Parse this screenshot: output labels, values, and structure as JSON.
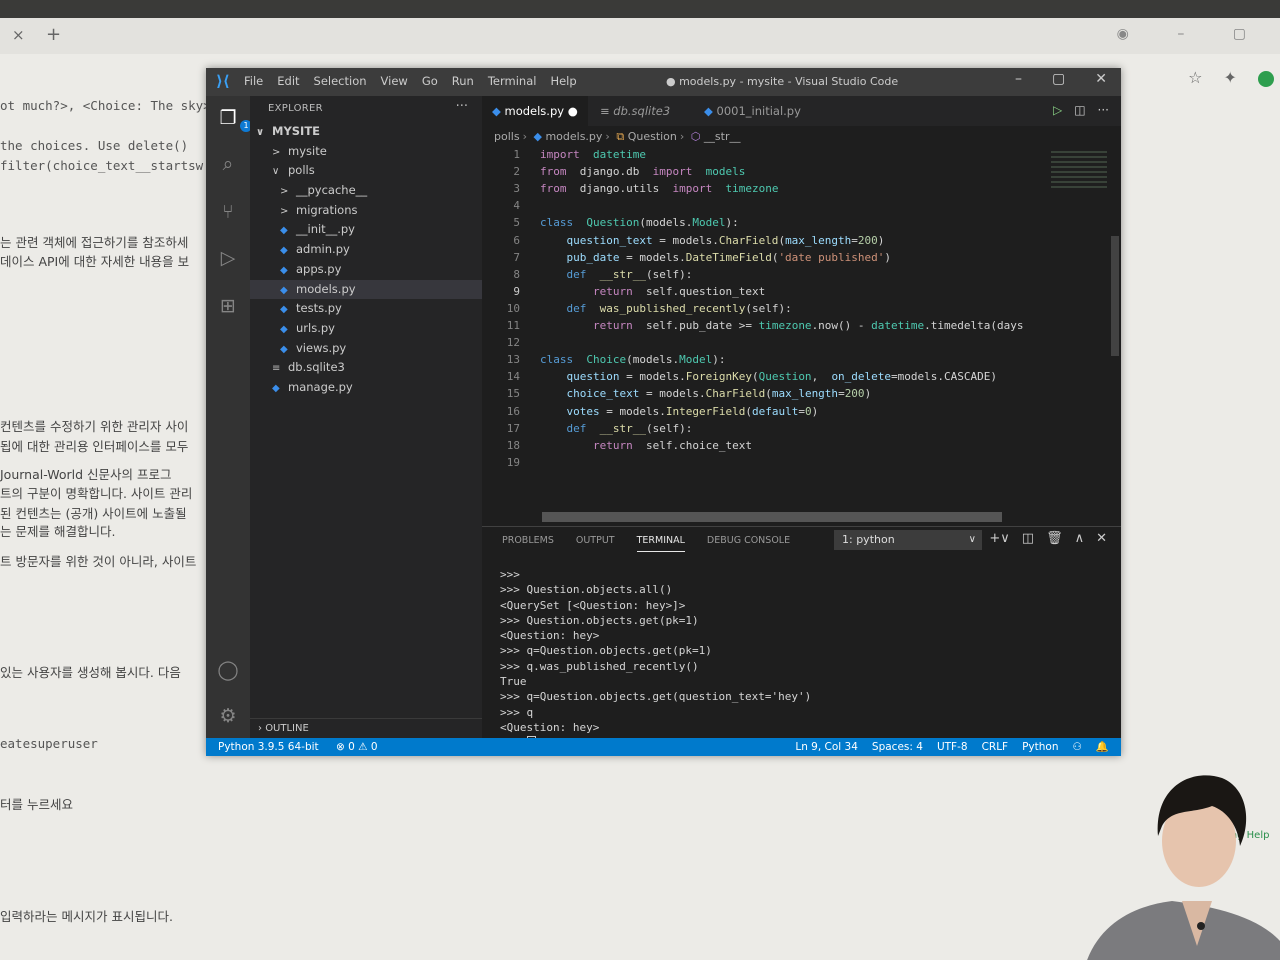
{
  "browser": {
    "tab_close": "×",
    "tab_new": "+",
    "controls": "◉ – ▢",
    "help_text": "ing Help"
  },
  "background_text": [
    {
      "text": "ot much?>, <Choice: The sky>",
      "mono": true
    },
    {
      "text": " the choices. Use delete()",
      "mono": true
    },
    {
      "text": "filter(choice_text__startsw",
      "mono": true
    },
    {
      "text": "는 관련 객체에 접근하기를 참조하세",
      "mono": false
    },
    {
      "text": "데이스 API에 대한 자세한 내용을 보",
      "mono": false
    },
    {
      "text": "컨텐츠를 수정하기 위한 관리자 사이",
      "mono": false
    },
    {
      "text": "됩에 대한 관리용 인터페이스를 모두",
      "mono": false
    },
    {
      "text": "Journal-World 신문사의 프로그",
      "mono": false
    },
    {
      "text": "트의 구분이 명확합니다. 사이트 관리",
      "mono": false
    },
    {
      "text": "된 컨텐츠는 (공개) 사이트에 노출될",
      "mono": false
    },
    {
      "text": "는 문제를 해결합니다.",
      "mono": false
    },
    {
      "text": "트 방문자를 위한 것이 아니라, 사이트",
      "mono": false
    },
    {
      "text": "있는 사용자를 생성해 봅시다. 다음",
      "mono": false
    },
    {
      "text": "eatesuperuser",
      "mono": true
    },
    {
      "text": "터를 누르세요",
      "mono": false
    },
    {
      "text": "입력하라는 메시지가 표시됩니다.",
      "mono": false
    }
  ],
  "vscode": {
    "menu": [
      "File",
      "Edit",
      "Selection",
      "View",
      "Go",
      "Run",
      "Terminal",
      "Help"
    ],
    "window_title": "● models.py - mysite - Visual Studio Code",
    "explorer_title": "EXPLORER",
    "explorer_more": "···",
    "badge": "1",
    "tree": [
      {
        "label": "MYSITE",
        "kind": "root",
        "chev": "∨"
      },
      {
        "label": "mysite",
        "kind": "folder",
        "chev": ">"
      },
      {
        "label": "polls",
        "kind": "folder",
        "chev": "∨"
      },
      {
        "label": "__pycache__",
        "kind": "folder",
        "chev": ">"
      },
      {
        "label": "migrations",
        "kind": "folder",
        "chev": ">"
      },
      {
        "label": "__init__.py",
        "kind": "py"
      },
      {
        "label": "admin.py",
        "kind": "py"
      },
      {
        "label": "apps.py",
        "kind": "py"
      },
      {
        "label": "models.py",
        "kind": "py",
        "selected": true
      },
      {
        "label": "tests.py",
        "kind": "py"
      },
      {
        "label": "urls.py",
        "kind": "py"
      },
      {
        "label": "views.py",
        "kind": "py"
      },
      {
        "label": "db.sqlite3",
        "kind": "db"
      },
      {
        "label": "manage.py",
        "kind": "py"
      }
    ],
    "outline": "OUTLINE",
    "tabs": [
      {
        "label": "models.py",
        "modified": "●"
      },
      {
        "label": "db.sqlite3"
      },
      {
        "label": "0001_initial.py"
      }
    ],
    "breadcrumbs": [
      "polls",
      "models.py",
      "Question",
      "__str__"
    ],
    "code": [
      [
        [
          "kw",
          "import"
        ],
        [
          "",
          "  "
        ],
        [
          "cls",
          "datetime"
        ]
      ],
      [
        [
          "kw",
          "from"
        ],
        [
          "",
          "  django.db  "
        ],
        [
          "kw",
          "import"
        ],
        [
          "",
          "  "
        ],
        [
          "cls",
          "models"
        ]
      ],
      [
        [
          "kw",
          "from"
        ],
        [
          "",
          "  django.utils  "
        ],
        [
          "kw",
          "import"
        ],
        [
          "",
          "  "
        ],
        [
          "cls",
          "timezone"
        ]
      ],
      [],
      [
        [
          "kw2",
          "class"
        ],
        [
          "",
          "  "
        ],
        [
          "cls",
          "Question"
        ],
        [
          "",
          "(models."
        ],
        [
          "cls",
          "Model"
        ],
        [
          "",
          "):"
        ]
      ],
      [
        [
          "",
          "    "
        ],
        [
          "var",
          "question_text"
        ],
        [
          "",
          " = models."
        ],
        [
          "fn",
          "CharField"
        ],
        [
          "",
          "("
        ],
        [
          "var",
          "max_length"
        ],
        [
          "",
          "="
        ],
        [
          "num",
          "200"
        ],
        [
          "",
          ")"
        ]
      ],
      [
        [
          "",
          "    "
        ],
        [
          "var",
          "pub_date"
        ],
        [
          "",
          " = models."
        ],
        [
          "fn",
          "DateTimeField"
        ],
        [
          "",
          "("
        ],
        [
          "str",
          "'date published'"
        ],
        [
          "",
          ")"
        ]
      ],
      [
        [
          "",
          "    "
        ],
        [
          "kw2",
          "def"
        ],
        [
          "",
          "  "
        ],
        [
          "fn",
          "__str__"
        ],
        [
          "",
          "(self):"
        ]
      ],
      [
        [
          "",
          "        "
        ],
        [
          "kw",
          "return"
        ],
        [
          "",
          "  self.question_text"
        ]
      ],
      [
        [
          "",
          "    "
        ],
        [
          "kw2",
          "def"
        ],
        [
          "",
          "  "
        ],
        [
          "fn",
          "was_published_recently"
        ],
        [
          "",
          "(self):"
        ]
      ],
      [
        [
          "",
          "        "
        ],
        [
          "kw",
          "return"
        ],
        [
          "",
          "  self.pub_date >= "
        ],
        [
          "cls",
          "timezone"
        ],
        [
          "",
          ".now() - "
        ],
        [
          "cls",
          "datetime"
        ],
        [
          "",
          ".timedelta(days"
        ]
      ],
      [],
      [
        [
          "kw2",
          "class"
        ],
        [
          "",
          "  "
        ],
        [
          "cls",
          "Choice"
        ],
        [
          "",
          "(models."
        ],
        [
          "cls",
          "Model"
        ],
        [
          "",
          "):"
        ]
      ],
      [
        [
          "",
          "    "
        ],
        [
          "var",
          "question"
        ],
        [
          "",
          " = models."
        ],
        [
          "fn",
          "ForeignKey"
        ],
        [
          "",
          "("
        ],
        [
          "cls",
          "Question"
        ],
        [
          "",
          ",  "
        ],
        [
          "var",
          "on_delete"
        ],
        [
          "",
          "=models.CASCADE)"
        ]
      ],
      [
        [
          "",
          "    "
        ],
        [
          "var",
          "choice_text"
        ],
        [
          "",
          " = models."
        ],
        [
          "fn",
          "CharField"
        ],
        [
          "",
          "("
        ],
        [
          "var",
          "max_length"
        ],
        [
          "",
          "="
        ],
        [
          "num",
          "200"
        ],
        [
          "",
          ")"
        ]
      ],
      [
        [
          "",
          "    "
        ],
        [
          "var",
          "votes"
        ],
        [
          "",
          " = models."
        ],
        [
          "fn",
          "IntegerField"
        ],
        [
          "",
          "("
        ],
        [
          "var",
          "default"
        ],
        [
          "",
          "="
        ],
        [
          "num",
          "0"
        ],
        [
          "",
          ")"
        ]
      ],
      [
        [
          "",
          "    "
        ],
        [
          "kw2",
          "def"
        ],
        [
          "",
          "  "
        ],
        [
          "fn",
          "__str__"
        ],
        [
          "",
          "(self):"
        ]
      ],
      [
        [
          "",
          "        "
        ],
        [
          "kw",
          "return"
        ],
        [
          "",
          "  self.choice_text"
        ]
      ],
      []
    ],
    "current_line": 9,
    "panel_tabs": [
      "PROBLEMS",
      "OUTPUT",
      "TERMINAL",
      "DEBUG CONSOLE"
    ],
    "panel_active": "TERMINAL",
    "terminal_select": "1: python",
    "terminal": [
      ">>>",
      ">>> Question.objects.all()",
      "<QuerySet [<Question: hey>]>",
      ">>> Question.objects.get(pk=1)",
      "<Question: hey>",
      ">>> q=Question.objects.get(pk=1)",
      ">>> q.was_published_recently()",
      "True",
      ">>> q=Question.objects.get(question_text='hey')",
      ">>> q",
      "<Question: hey>",
      ">>> "
    ],
    "status_left": {
      "interpreter": "Python 3.9.5 64-bit",
      "problems": "⊗ 0  ⚠ 0"
    },
    "status_right": [
      "Ln 9, Col 34",
      "Spaces: 4",
      "UTF-8",
      "CRLF",
      "Python",
      "⚇",
      "🔔"
    ]
  }
}
